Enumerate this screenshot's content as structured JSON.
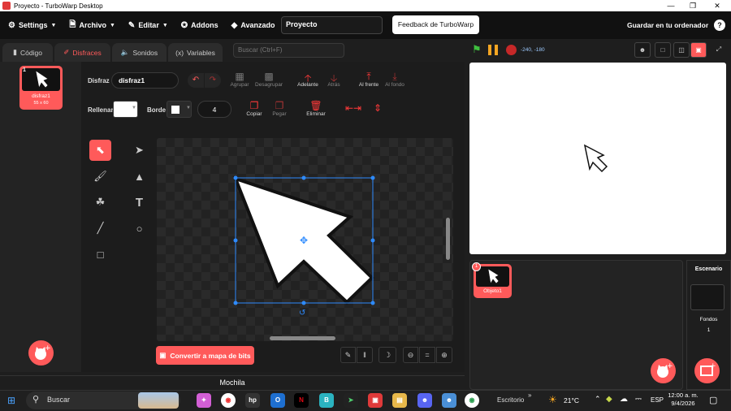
{
  "window": {
    "title": "Proyecto - TurboWarp Desktop"
  },
  "menubar": {
    "settings": "Settings",
    "file": "Archivo",
    "edit": "Editar",
    "addons": "Addons",
    "advanced": "Avanzado",
    "project_title": "Proyecto",
    "feedback": "Feedback de TurboWarp",
    "save_computer": "Guardar en tu ordenador",
    "help": "?"
  },
  "tabs": {
    "code": "Código",
    "costumes": "Disfraces",
    "sounds": "Sonidos",
    "variables": "Variables"
  },
  "search": {
    "placeholder": "Buscar (Ctrl+F)"
  },
  "costume_list": {
    "items": [
      {
        "number": "1",
        "name": "disfraz1",
        "size": "55 x 60"
      }
    ]
  },
  "editor": {
    "costume_label": "Disfraz",
    "costume_name": "disfraz1",
    "fill_label": "Rellenar",
    "border_label": "Borde",
    "border_width": "4",
    "actions": {
      "group": "Agrupar",
      "ungroup": "Desagrupar",
      "forward": "Adelante",
      "backward": "Atrás",
      "front": "Al frente",
      "back": "Al fondo",
      "copy": "Copiar",
      "paste": "Pegar",
      "delete": "Eliminar"
    },
    "convert_bitmap": "Convertir a mapa de bits",
    "zoom_reset": "="
  },
  "backpack": {
    "label": "Mochila"
  },
  "stage": {
    "coords": "-240, -180"
  },
  "sprites": {
    "items": [
      {
        "number": "1",
        "name": "Objeto1"
      }
    ]
  },
  "stage_panel": {
    "title": "Escenario",
    "backdrops_label": "Fondos",
    "backdrops_count": "1"
  },
  "taskbar": {
    "search": "Buscar",
    "desktop_label": "Escritorio",
    "temperature": "21°C",
    "language": "ESP",
    "time": "12:00 a. m.",
    "date": "9/4/2026"
  },
  "colors": {
    "accent": "#ff5a5a",
    "green_flag": "#3fbf3f",
    "pause": "#f5a623",
    "stop": "#c62828"
  }
}
